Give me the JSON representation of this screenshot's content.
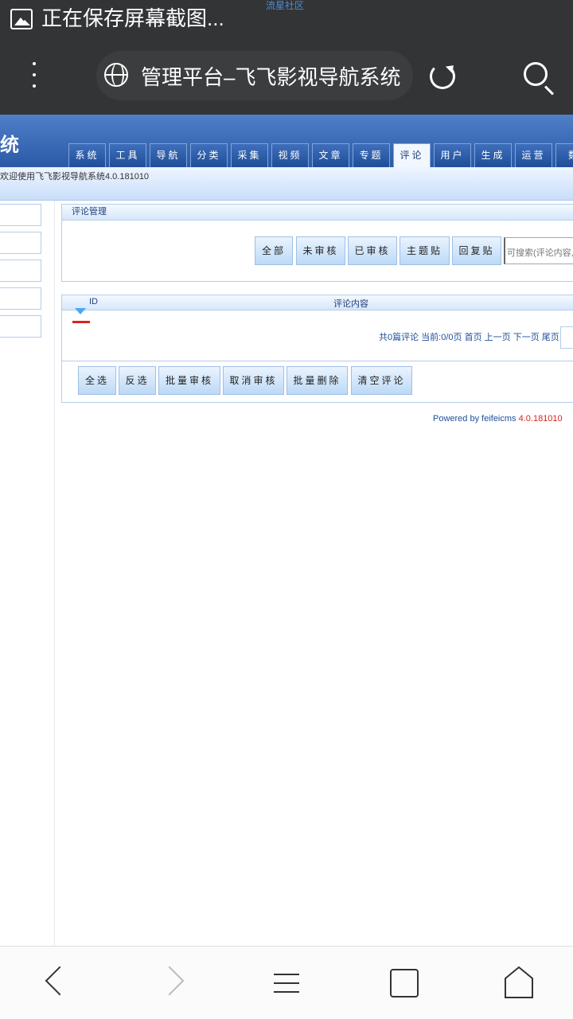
{
  "status": {
    "text": "正在保存屏幕截图...",
    "watermark": "流星社区"
  },
  "browser": {
    "page_title": "管理平台–飞飞影视导航系统"
  },
  "header": {
    "brand": "统",
    "tabs": [
      "系统",
      "工具",
      "导航",
      "分类",
      "采集",
      "视频",
      "文章",
      "专题",
      "评论",
      "用户",
      "生成",
      "运营",
      "数"
    ],
    "active_tab": "评论",
    "welcome": "欢迎使用飞飞影视导航系统4.0.181010"
  },
  "filter_panel": {
    "title": "评论管理",
    "buttons": [
      "全部",
      "未审核",
      "已审核",
      "主题贴",
      "回复贴"
    ],
    "search_placeholder": "可搜索(评论内容,用"
  },
  "list": {
    "columns": [
      "ID",
      "评论内容"
    ],
    "pager": "共0篇评论 当前:0/0页 首页 上一页 下一页 尾页"
  },
  "actions": {
    "buttons": [
      "全选",
      "反选",
      "批量审核",
      "取消审核",
      "批量删除",
      "清空评论"
    ]
  },
  "footer": {
    "powered_label": "Powered by feifeicms",
    "version": "4.0.181010"
  }
}
